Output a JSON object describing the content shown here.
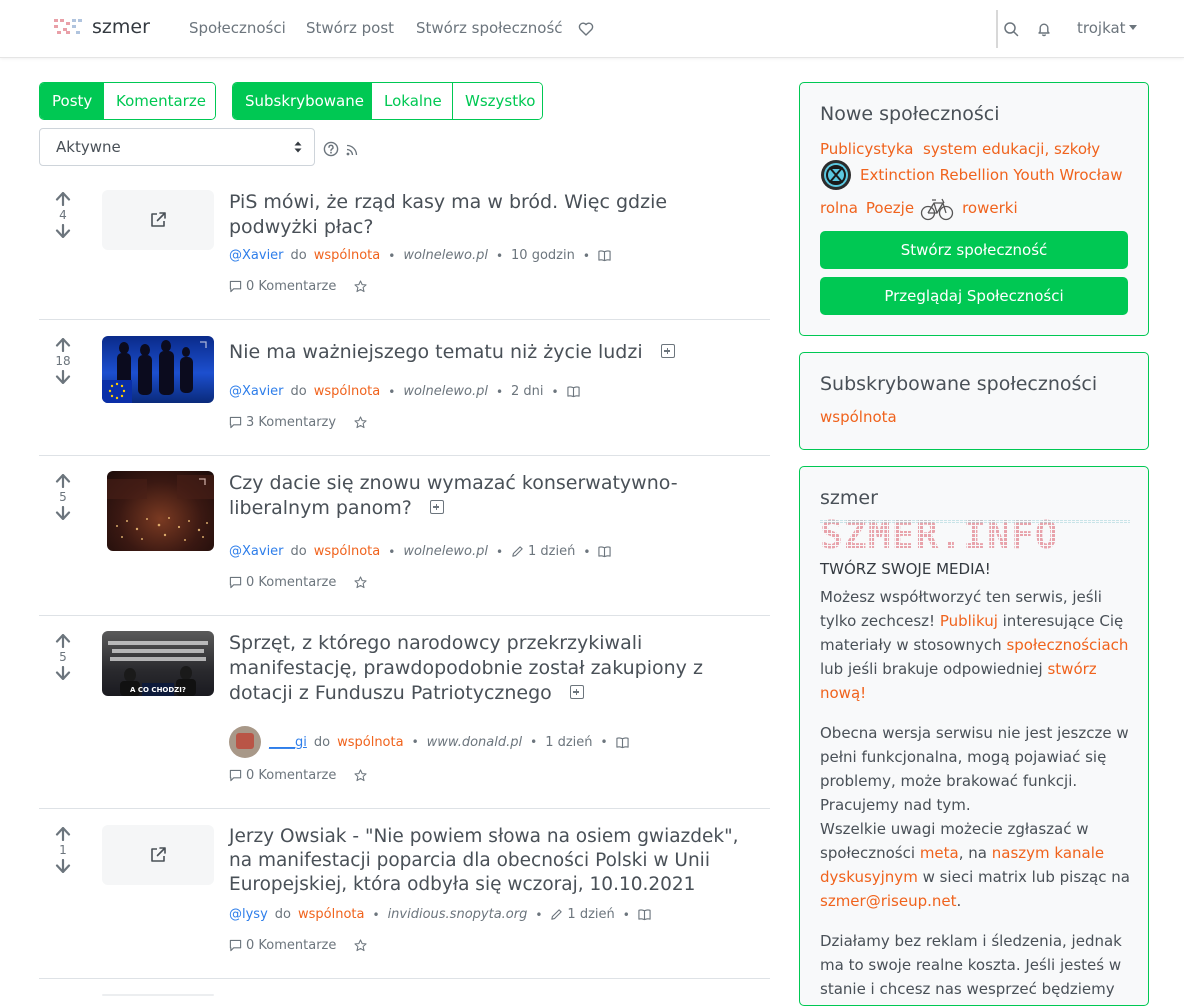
{
  "nav": {
    "brand": "szmer",
    "links": [
      "Społeczności",
      "Stwórz post",
      "Stwórz społeczność"
    ],
    "user": "trojkat"
  },
  "tabs": {
    "type": [
      "Posty",
      "Komentarze"
    ],
    "listing": [
      "Subskrybowane",
      "Lokalne",
      "Wszystko"
    ]
  },
  "sort": {
    "selected": "Aktywne"
  },
  "posts": [
    {
      "score": "4",
      "title": "PiS mówi, że rząd kasy ma w bród. Więc gdzie podwyżki płac?",
      "user": "@Xavier",
      "to": "do",
      "community": "wspólnota",
      "domain": "wolnelewo.pl",
      "time": "10 godzin",
      "comments": "0 Komentarze"
    },
    {
      "score": "18",
      "title": "Nie ma ważniejszego tematu niż życie ludzi",
      "user": "@Xavier",
      "to": "do",
      "community": "wspólnota",
      "domain": "wolnelewo.pl",
      "time": "2 dni",
      "comments": "3 Komentarzy"
    },
    {
      "score": "5",
      "title": "Czy dacie się znowu wymazać konserwatywno-liberalnym panom?",
      "user": "@Xavier",
      "to": "do",
      "community": "wspólnota",
      "domain": "wolnelewo.pl",
      "time": "1 dzień",
      "comments": "0 Komentarze"
    },
    {
      "score": "5",
      "title": "Sprzęt, z którego narodowcy przekrzykiwali manifestację, prawdopodobnie został zakupiony z dotacji z Funduszu Patriotycznego",
      "user": "____gi",
      "to": "do",
      "community": "wspólnota",
      "domain": "www.donald.pl",
      "time": "1 dzień",
      "comments": "0 Komentarze",
      "thumb_caption": "A CO CHODZI?"
    },
    {
      "score": "1",
      "title": "Jerzy Owsiak - \"Nie powiem słowa na osiem gwiazdek\", na manifestacji poparcia dla obecności Polski w Unii Europejskiej, która odbyła się wczoraj, 10.10.2021",
      "user": "@lysy",
      "to": "do",
      "community": "wspólnota",
      "domain": "invidious.snopyta.org",
      "time": "1 dzień",
      "comments": "0 Komentarze"
    }
  ],
  "sidebar": {
    "new_communities": {
      "title": "Nowe społeczności",
      "items": [
        "Publicystyka",
        "system edukacji, szkoły",
        "Extinction Rebellion Youth Wrocław",
        "rolna",
        "Poezje",
        "rowerki"
      ],
      "create_button": "Stwórz społeczność",
      "browse_button": "Przeglądaj Społeczności"
    },
    "subscribed": {
      "title": "Subskrybowane społeczności",
      "items": [
        "wspólnota"
      ]
    },
    "about": {
      "title": "szmer",
      "logo_text": "SZMER.INFO",
      "slogan": "TWÓRZ SWOJE MEDIA!",
      "p1_a": "Możesz współtworzyć ten serwis, jeśli tylko zechcesz! ",
      "p1_link1": "Publikuj",
      "p1_b": " interesujące Cię materiały w stosownych ",
      "p1_link2": "społecznościach",
      "p1_c": " lub jeśli brakuje odpowiedniej ",
      "p1_link3": "stwórz nową!",
      "p2_a": "Obecna wersja serwisu nie jest jeszcze w pełni funkcjonalna, mogą pojawiać się problemy, może brakować funkcji. Pracujemy nad tym.",
      "p2_b": "Wszelkie uwagi możecie zgłaszać w społeczności ",
      "p2_link1": "meta",
      "p2_c": ", na ",
      "p2_link2": "naszym kanale dyskusyjnym",
      "p2_d": " w sieci matrix lub pisząc na ",
      "p2_link3": "szmer@riseup.net",
      "p2_e": ".",
      "p3": "Działamy bez reklam i śledzenia, jednak ma to swoje realne koszta. Jeśli jesteś w stanie i chcesz nas wesprzeć będziemy"
    }
  },
  "colors": {
    "accent": "#00c853",
    "link": "#f0631d",
    "user": "#2e7eea"
  }
}
